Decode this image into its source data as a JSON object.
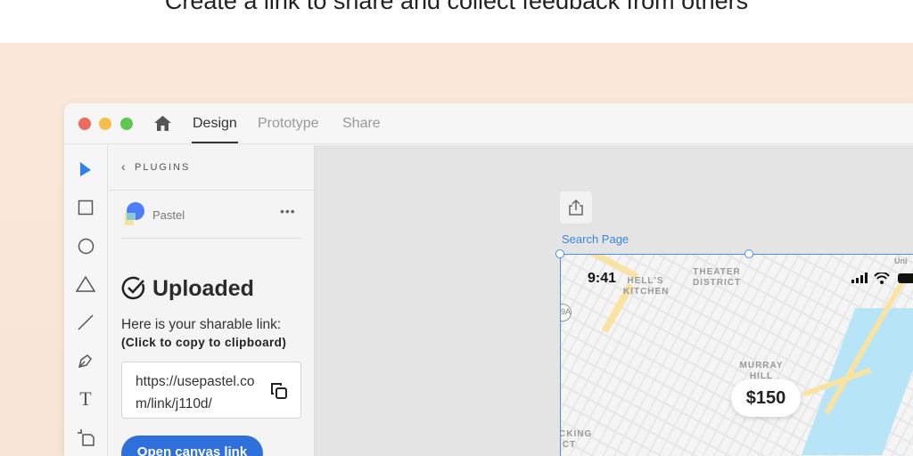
{
  "headline": "Create a link to share and collect feedback from others",
  "window": {
    "tabs": [
      {
        "label": "Design",
        "active": true
      },
      {
        "label": "Prototype",
        "active": false
      },
      {
        "label": "Share",
        "active": false
      }
    ]
  },
  "panel": {
    "back_label": "PLUGINS",
    "plugin_name": "Pastel",
    "more_label": "•••",
    "status": "Uploaded",
    "share_text": "Here is your sharable link:",
    "copy_hint": "(Click to copy to clipboard)",
    "link": "https://usepastel.com/link/j110d/",
    "open_button": "Open canvas link"
  },
  "canvas": {
    "artboard_label": "Search Page",
    "status_time": "9:41",
    "map_labels": {
      "hells_kitchen": "HELL'S KITCHEN",
      "theater": "THEATER DISTRICT",
      "murray": "MURRAY HILL",
      "packing": "CKING ICT",
      "route": "9A",
      "uni": "Uni"
    },
    "price": "$150"
  },
  "colors": {
    "accent": "#2f6fdc",
    "selection": "#4a90e2"
  }
}
